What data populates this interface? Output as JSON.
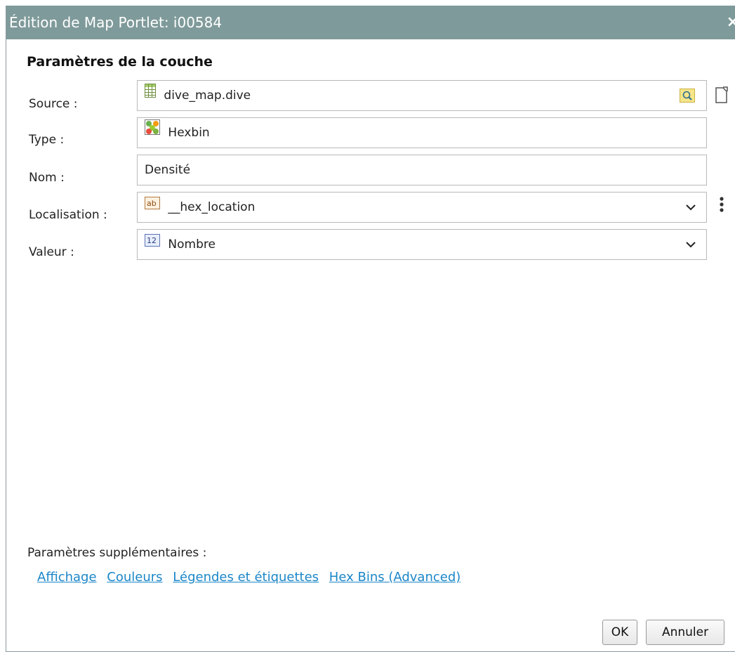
{
  "dialog": {
    "title": "Édition de Map Portlet: i00584",
    "close_glyph": "×"
  },
  "section": {
    "title": "Paramètres de la couche"
  },
  "fields": {
    "source": {
      "label": "Source :",
      "value": "dive_map.dive",
      "icon": "table-icon"
    },
    "type": {
      "label": "Type :",
      "value": "Hexbin",
      "icon": "hexbin-icon"
    },
    "name": {
      "label": "Nom :",
      "value": "Densité"
    },
    "location": {
      "label": "Localisation :",
      "value": "__hex_location",
      "icon": "text-field-icon"
    },
    "value": {
      "label": "Valeur :",
      "value": "Nombre",
      "icon": "number-field-icon"
    }
  },
  "extra": {
    "label": "Paramètres supplémentaires :",
    "links": [
      "Affichage",
      "Couleurs",
      "Légendes et étiquettes",
      "Hex Bins (Advanced)"
    ]
  },
  "buttons": {
    "ok": "OK",
    "cancel": "Annuler"
  },
  "colors": {
    "titlebar": "#7f9a9a",
    "link": "#1b86c8"
  }
}
